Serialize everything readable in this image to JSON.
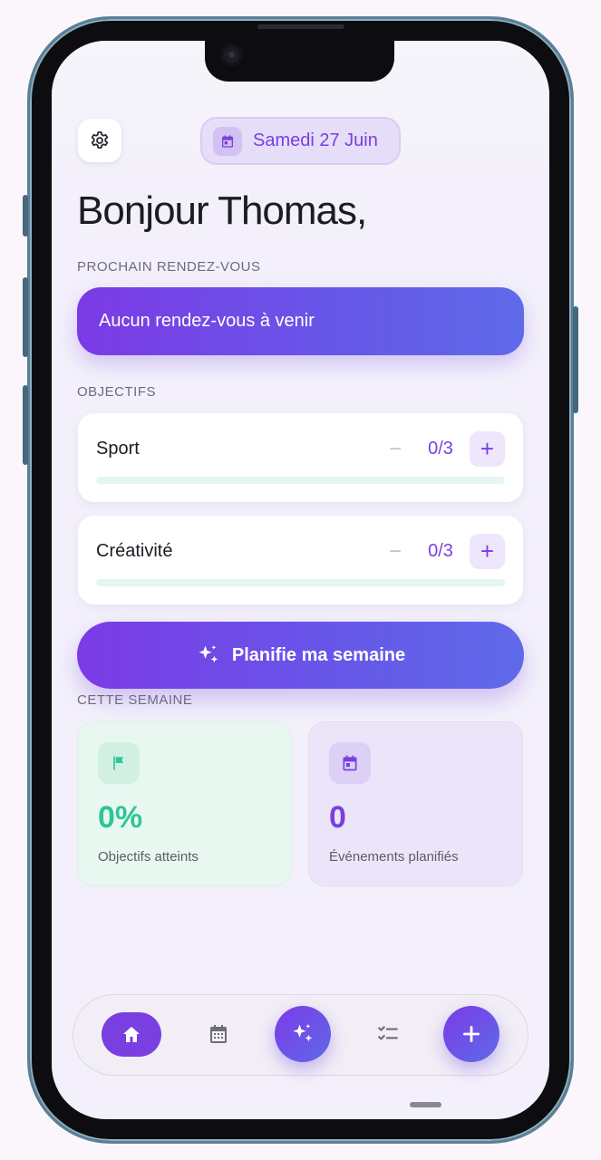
{
  "header": {
    "date_label": "Samedi 27 Juin"
  },
  "greeting": "Bonjour Thomas,",
  "next_appointment": {
    "section_label": "PROCHAIN RENDEZ-VOUS",
    "text": "Aucun rendez-vous à venir"
  },
  "objectives": {
    "section_label": "OBJECTIFS",
    "items": [
      {
        "name": "Sport",
        "count": "0/3",
        "progress": 0
      },
      {
        "name": "Créativité",
        "count": "0/3",
        "progress": 0
      }
    ]
  },
  "plan_button": {
    "label": "Planifie ma semaine"
  },
  "week": {
    "section_label": "CETTE SEMAINE",
    "stats": [
      {
        "value": "0%",
        "label": "Objectifs atteints",
        "icon": "flag-icon",
        "color": "#2fc49a"
      },
      {
        "value": "0",
        "label": "Événements planifiés",
        "icon": "calendar-icon",
        "color": "#7a3fe0"
      }
    ]
  },
  "nav": {
    "items": [
      "home-icon",
      "calendar-icon",
      "sparkles-icon",
      "checklist-icon",
      "plus-icon"
    ]
  },
  "colors": {
    "accent": "#7a3fe0",
    "gradient_end": "#5f6ae9",
    "success": "#2fc49a"
  }
}
